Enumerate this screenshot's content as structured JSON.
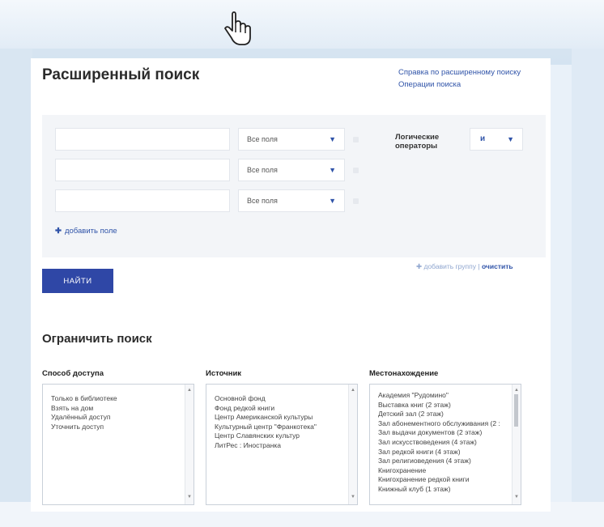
{
  "page_title": "Расширенный поиск",
  "help_links": [
    "Справка по расширенному поиску",
    "Операции поиска"
  ],
  "search_rows": [
    {
      "value": "",
      "field_select": "Все поля"
    },
    {
      "value": "",
      "field_select": "Все поля"
    },
    {
      "value": "",
      "field_select": "Все поля"
    }
  ],
  "logic": {
    "label_line1": "Логические",
    "label_line2": "операторы",
    "value": "и"
  },
  "add_field_label": "добавить поле",
  "add_group_label": "добавить группу",
  "separator": "|",
  "clear_label": "очистить",
  "find_button": "НАЙТИ",
  "limit_title": "Ограничить поиск",
  "access": {
    "label": "Способ доступа",
    "options": [
      "Только в библиотеке",
      "Взять на дом",
      "Удалённый доступ",
      "Уточнить доступ"
    ]
  },
  "source": {
    "label": "Источник",
    "options": [
      "Основной фонд",
      "Фонд редкой книги",
      "Центр Американской культуры",
      "Культурный центр \"Франкотека\"",
      "Центр Славянских культур",
      "ЛитРес : Иностранка"
    ]
  },
  "location": {
    "label": "Местонахождение",
    "options": [
      "Академия \"Рудомино\"",
      "Выставка книг (2 этаж)",
      "Детский зал (2 этаж)",
      "Зал абонементного обслуживания (2 :",
      "Зал выдачи документов (2 этаж)",
      "Зал искусствоведения (4 этаж)",
      "Зал редкой книги (4 этаж)",
      "Зал религиоведения (4 этаж)",
      "Книгохранение",
      "Книгохранение редкой книги",
      "Книжный клуб (1 этаж)"
    ]
  },
  "icons": {
    "pointer": "hand-pointer-icon",
    "dropdown": "chevron-down-icon",
    "add": "plus-icon"
  }
}
